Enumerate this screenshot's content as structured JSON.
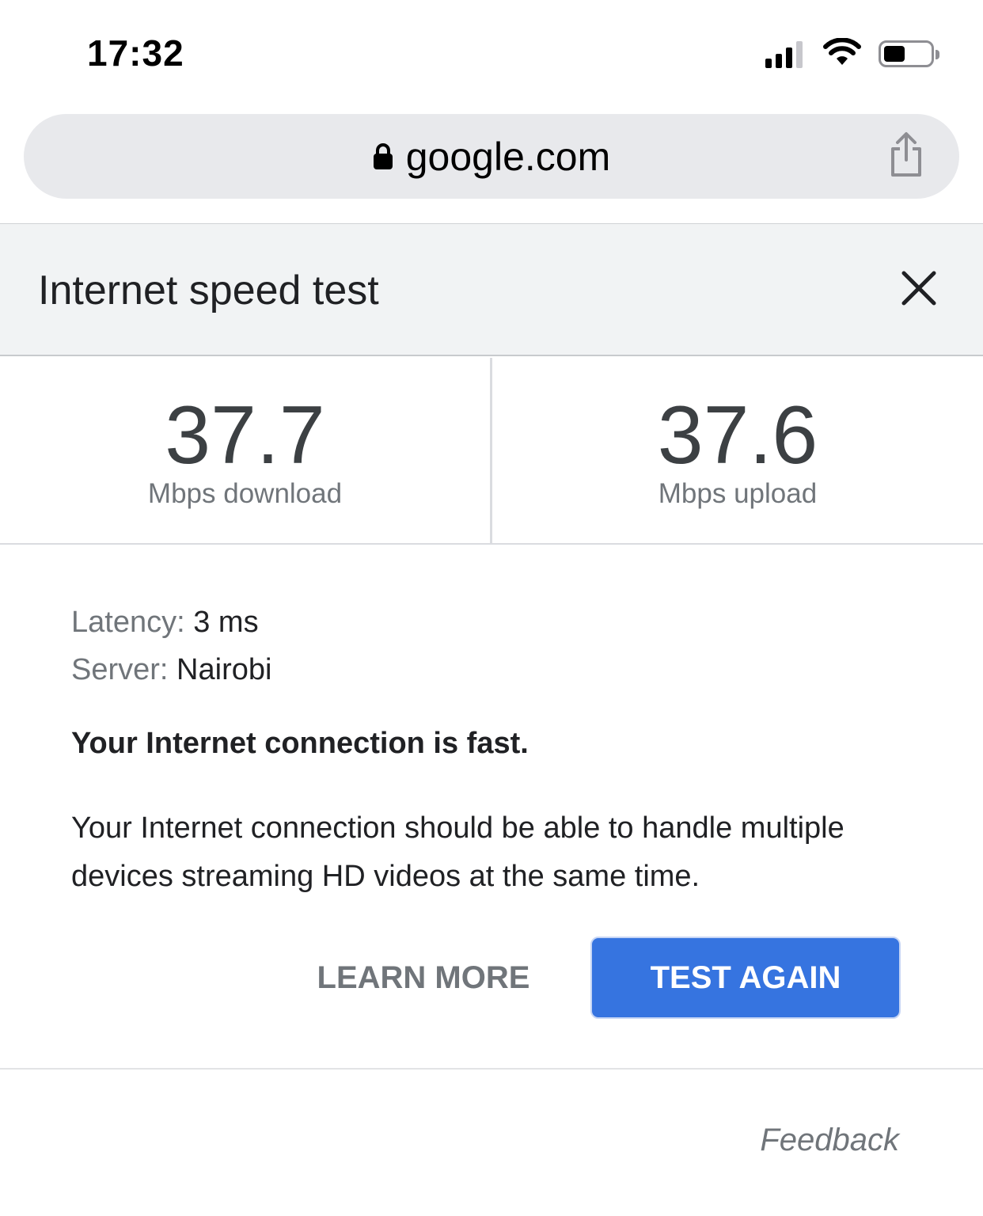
{
  "status_bar": {
    "time": "17:32",
    "icons": [
      "cellular-signal-icon",
      "wifi-icon",
      "battery-icon"
    ]
  },
  "browser": {
    "url": "google.com",
    "lock_icon": "lock-icon",
    "share_icon": "share-icon"
  },
  "card": {
    "title": "Internet speed test",
    "close_icon": "close-icon"
  },
  "results": {
    "download": {
      "value": "37.7",
      "unit": "Mbps download"
    },
    "upload": {
      "value": "37.6",
      "unit": "Mbps upload"
    }
  },
  "details": {
    "latency_label": "Latency:",
    "latency_value": "3 ms",
    "server_label": "Server:",
    "server_value": "Nairobi"
  },
  "verdict": "Your Internet connection is fast.",
  "description": "Your Internet connection should be able to handle multiple devices streaming HD videos at the same time.",
  "actions": {
    "learn_more": "LEARN MORE",
    "test_again": "TEST AGAIN"
  },
  "feedback": "Feedback",
  "colors": {
    "accent": "#3674e0",
    "header_bg": "#f1f3f4",
    "url_bar_bg": "#e8e9ec",
    "muted_text": "#70757a"
  }
}
